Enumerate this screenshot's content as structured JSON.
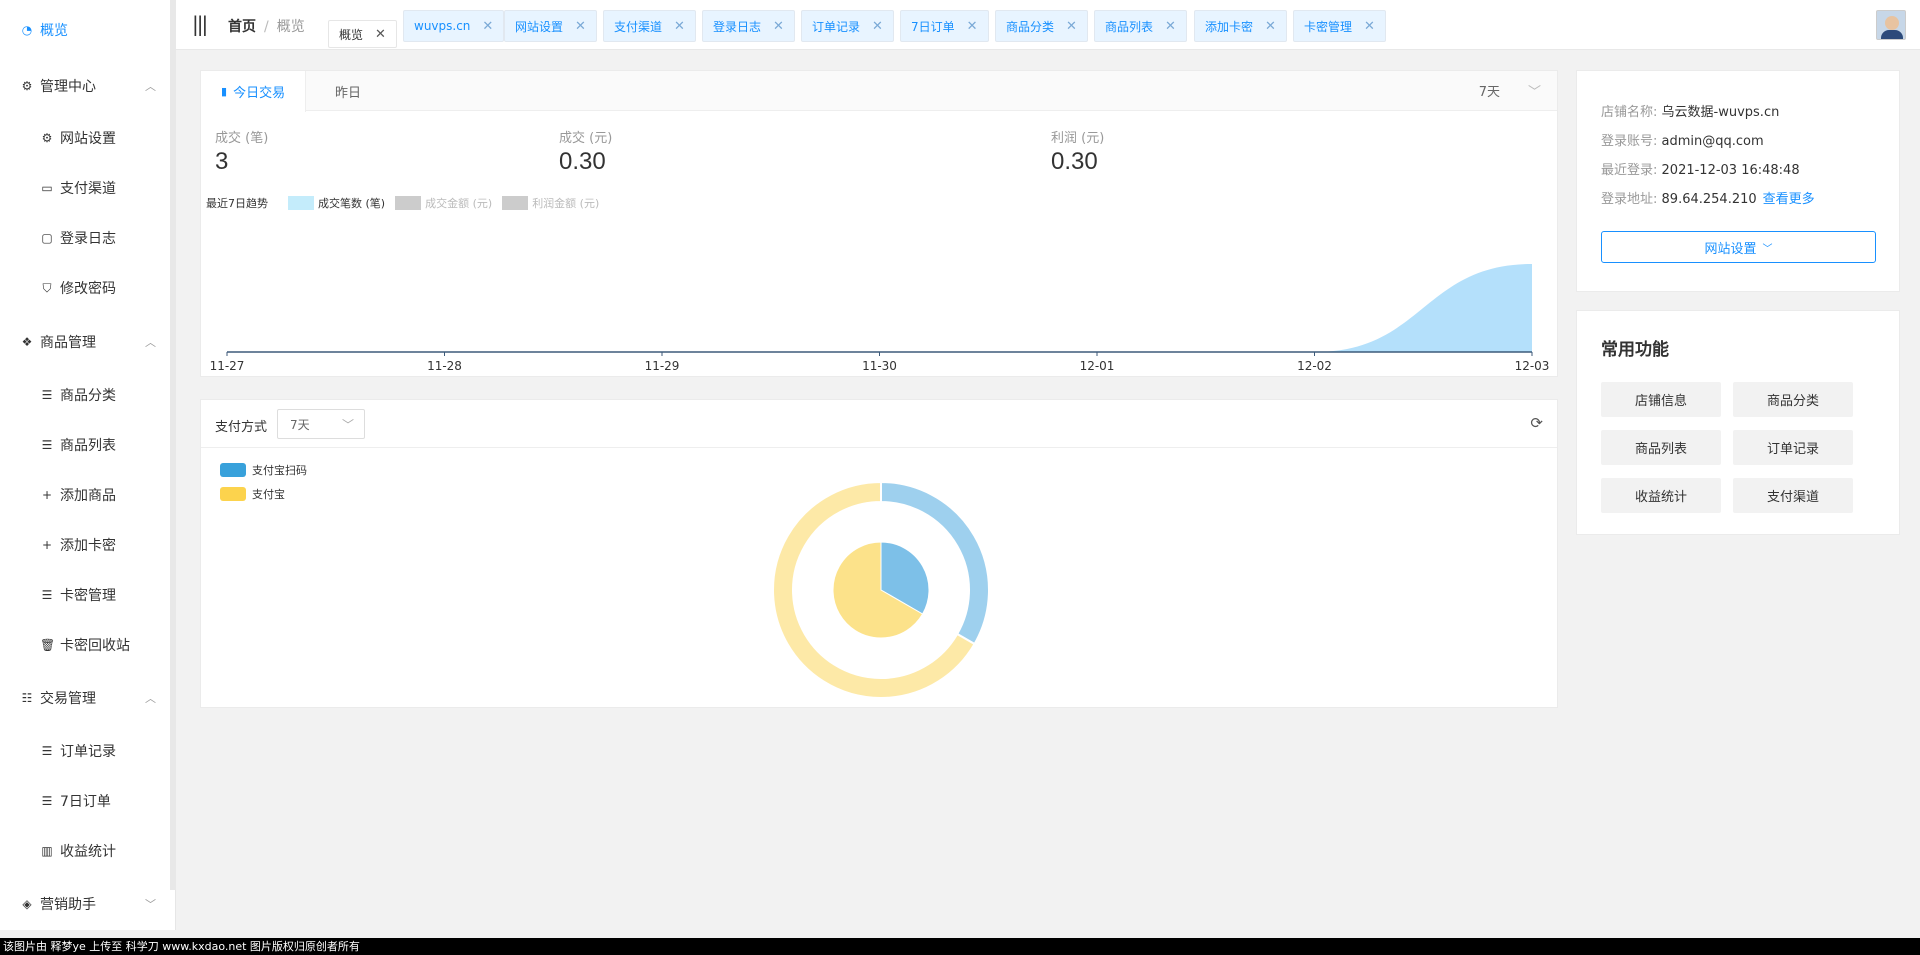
{
  "sidebar": {
    "top_item": "概览",
    "groups": [
      {
        "label": "管理中心",
        "items": [
          "网站设置",
          "支付渠道",
          "登录日志",
          "修改密码"
        ]
      },
      {
        "label": "商品管理",
        "items": [
          "商品分类",
          "商品列表",
          "添加商品",
          "添加卡密",
          "卡密管理",
          "卡密回收站"
        ]
      },
      {
        "label": "交易管理",
        "items": [
          "订单记录",
          "7日订单",
          "收益统计"
        ]
      },
      {
        "label": "营销助手",
        "items": []
      }
    ]
  },
  "header": {
    "breadcrumb_home": "首页",
    "breadcrumb_sep": "/",
    "breadcrumb_current": "概览",
    "tabs": [
      "概览",
      "wuvps.cn",
      "网站设置",
      "支付渠道",
      "登录日志",
      "订单记录",
      "7日订单",
      "商品分类",
      "商品列表",
      "添加卡密",
      "卡密管理"
    ]
  },
  "trade": {
    "tab_today": "今日交易",
    "tab_yesterday": "昨日",
    "range": "7天",
    "stats": [
      {
        "label": "成交 (笔)",
        "value": "3"
      },
      {
        "label": "成交 (元)",
        "value": "0.30"
      },
      {
        "label": "利润 (元)",
        "value": "0.30"
      }
    ],
    "trend_label": "最近7日趋势",
    "legend": [
      {
        "name": "成交笔数 (笔)",
        "color": "#c4ecfb",
        "text_color": "#333"
      },
      {
        "name": "成交金额 (元)",
        "color": "#cccccc",
        "text_color": "#bbb"
      },
      {
        "name": "利润金额 (元)",
        "color": "#cccccc",
        "text_color": "#bbb"
      }
    ]
  },
  "chart_data": {
    "type": "area",
    "x": [
      "11-27",
      "11-28",
      "11-29",
      "11-30",
      "12-01",
      "12-02",
      "12-03"
    ],
    "series": [
      {
        "name": "成交笔数 (笔)",
        "values": [
          0,
          0,
          0,
          0,
          0,
          0,
          3
        ]
      }
    ],
    "color": "#b4e0fb"
  },
  "payment": {
    "title": "支付方式",
    "range": "7天",
    "legend": [
      {
        "name": "支付宝扫码",
        "color": "#38a1db"
      },
      {
        "name": "支付宝",
        "color": "#fcd34d"
      }
    ]
  },
  "pie_data": {
    "type": "pie",
    "slices": [
      {
        "name": "支付宝扫码",
        "value": 1,
        "color": "#7dc0e8"
      },
      {
        "name": "支付宝",
        "value": 2,
        "color": "#fce28a"
      }
    ]
  },
  "shop": {
    "name_key": "店铺名称:",
    "name_val": "乌云数据-wuvps.cn",
    "account_key": "登录账号:",
    "account_val": "admin@qq.com",
    "last_login_key": "最近登录:",
    "last_login_val": "2021-12-03 16:48:48",
    "ip_key": "登录地址:",
    "ip_val": "89.64.254.210",
    "more": "查看更多",
    "site_button": "网站设置"
  },
  "functions": {
    "title": "常用功能",
    "buttons": [
      "店铺信息",
      "商品分类",
      "商品列表",
      "订单记录",
      "收益统计",
      "支付渠道"
    ]
  },
  "footer_text": "该图片由 释梦ye 上传至 科学刀 www.kxdao.net 图片版权归原创者所有"
}
